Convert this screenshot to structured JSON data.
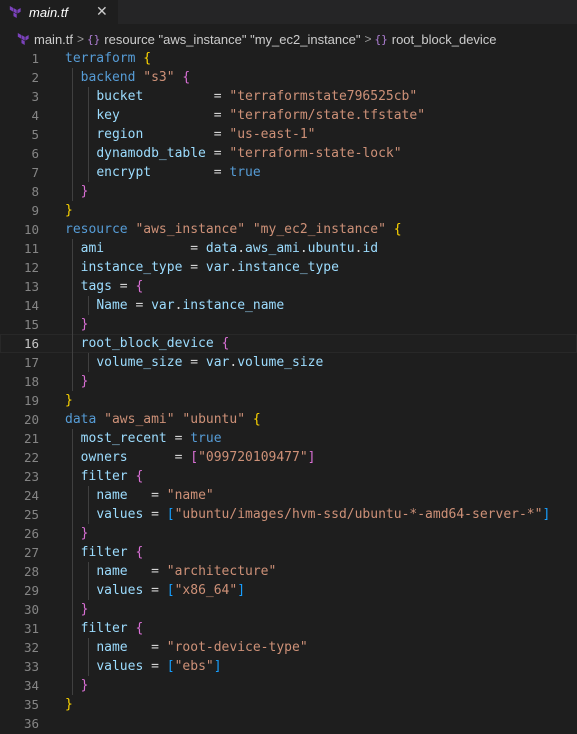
{
  "tab": {
    "filename": "main.tf",
    "close_glyph": "✕"
  },
  "breadcrumb": {
    "file": "main.tf",
    "resource": "resource \"aws_instance\" \"my_ec2_instance\"",
    "block": "root_block_device",
    "separator": ">"
  },
  "editor": {
    "current_line": 16,
    "lines": [
      {
        "n": "1",
        "tokens": [
          [
            "k",
            "terraform"
          ],
          [
            "op",
            " "
          ],
          [
            "br1",
            "{"
          ]
        ]
      },
      {
        "n": "2",
        "tokens": [
          [
            "op",
            "  "
          ],
          [
            "k",
            "backend"
          ],
          [
            "op",
            " "
          ],
          [
            "str",
            "\"s3\""
          ],
          [
            "op",
            " "
          ],
          [
            "br2",
            "{"
          ]
        ]
      },
      {
        "n": "3",
        "tokens": [
          [
            "op",
            "    "
          ],
          [
            "id",
            "bucket"
          ],
          [
            "op",
            "         = "
          ],
          [
            "str",
            "\"terraformstate796525cb\""
          ]
        ]
      },
      {
        "n": "4",
        "tokens": [
          [
            "op",
            "    "
          ],
          [
            "id",
            "key"
          ],
          [
            "op",
            "            = "
          ],
          [
            "str",
            "\"terraform/state.tfstate\""
          ]
        ]
      },
      {
        "n": "5",
        "tokens": [
          [
            "op",
            "    "
          ],
          [
            "id",
            "region"
          ],
          [
            "op",
            "         = "
          ],
          [
            "str",
            "\"us-east-1\""
          ]
        ]
      },
      {
        "n": "6",
        "tokens": [
          [
            "op",
            "    "
          ],
          [
            "id",
            "dynamodb_table"
          ],
          [
            "op",
            " = "
          ],
          [
            "str",
            "\"terraform-state-lock\""
          ]
        ]
      },
      {
        "n": "7",
        "tokens": [
          [
            "op",
            "    "
          ],
          [
            "id",
            "encrypt"
          ],
          [
            "op",
            "        = "
          ],
          [
            "kw",
            "true"
          ]
        ]
      },
      {
        "n": "8",
        "tokens": [
          [
            "op",
            "  "
          ],
          [
            "br2",
            "}"
          ]
        ]
      },
      {
        "n": "9",
        "tokens": [
          [
            "br1",
            "}"
          ]
        ]
      },
      {
        "n": "10",
        "tokens": [
          [
            "k",
            "resource"
          ],
          [
            "op",
            " "
          ],
          [
            "str",
            "\"aws_instance\""
          ],
          [
            "op",
            " "
          ],
          [
            "str",
            "\"my_ec2_instance\""
          ],
          [
            "op",
            " "
          ],
          [
            "br1",
            "{"
          ]
        ]
      },
      {
        "n": "11",
        "tokens": [
          [
            "op",
            "  "
          ],
          [
            "id",
            "ami"
          ],
          [
            "op",
            "           = "
          ],
          [
            "id",
            "data"
          ],
          [
            "op",
            "."
          ],
          [
            "id",
            "aws_ami"
          ],
          [
            "op",
            "."
          ],
          [
            "id",
            "ubuntu"
          ],
          [
            "op",
            "."
          ],
          [
            "id",
            "id"
          ]
        ]
      },
      {
        "n": "12",
        "tokens": [
          [
            "op",
            "  "
          ],
          [
            "id",
            "instance_type"
          ],
          [
            "op",
            " = "
          ],
          [
            "id",
            "var"
          ],
          [
            "op",
            "."
          ],
          [
            "id",
            "instance_type"
          ]
        ]
      },
      {
        "n": "13",
        "tokens": [
          [
            "op",
            "  "
          ],
          [
            "id",
            "tags"
          ],
          [
            "op",
            " = "
          ],
          [
            "br2",
            "{"
          ]
        ]
      },
      {
        "n": "14",
        "tokens": [
          [
            "op",
            "    "
          ],
          [
            "id",
            "Name"
          ],
          [
            "op",
            " = "
          ],
          [
            "id",
            "var"
          ],
          [
            "op",
            "."
          ],
          [
            "id",
            "instance_name"
          ]
        ]
      },
      {
        "n": "15",
        "tokens": [
          [
            "op",
            "  "
          ],
          [
            "br2",
            "}"
          ]
        ]
      },
      {
        "n": "16",
        "tokens": [
          [
            "op",
            "  "
          ],
          [
            "id",
            "root_block_device"
          ],
          [
            "op",
            " "
          ],
          [
            "br2",
            "{"
          ]
        ]
      },
      {
        "n": "17",
        "tokens": [
          [
            "op",
            "    "
          ],
          [
            "id",
            "volume_size"
          ],
          [
            "op",
            " = "
          ],
          [
            "id",
            "var"
          ],
          [
            "op",
            "."
          ],
          [
            "id",
            "volume_size"
          ]
        ]
      },
      {
        "n": "18",
        "tokens": [
          [
            "op",
            "  "
          ],
          [
            "br2",
            "}"
          ]
        ]
      },
      {
        "n": "19",
        "tokens": [
          [
            "br1",
            "}"
          ]
        ]
      },
      {
        "n": "20",
        "tokens": [
          [
            "k",
            "data"
          ],
          [
            "op",
            " "
          ],
          [
            "str",
            "\"aws_ami\""
          ],
          [
            "op",
            " "
          ],
          [
            "str",
            "\"ubuntu\""
          ],
          [
            "op",
            " "
          ],
          [
            "br1",
            "{"
          ]
        ]
      },
      {
        "n": "21",
        "tokens": [
          [
            "op",
            "  "
          ],
          [
            "id",
            "most_recent"
          ],
          [
            "op",
            " = "
          ],
          [
            "kw",
            "true"
          ]
        ]
      },
      {
        "n": "22",
        "tokens": [
          [
            "op",
            "  "
          ],
          [
            "id",
            "owners"
          ],
          [
            "op",
            "      = "
          ],
          [
            "br2",
            "["
          ],
          [
            "str",
            "\"099720109477\""
          ],
          [
            "br2",
            "]"
          ]
        ]
      },
      {
        "n": "23",
        "tokens": [
          [
            "op",
            "  "
          ],
          [
            "id",
            "filter"
          ],
          [
            "op",
            " "
          ],
          [
            "br2",
            "{"
          ]
        ]
      },
      {
        "n": "24",
        "tokens": [
          [
            "op",
            "    "
          ],
          [
            "id",
            "name"
          ],
          [
            "op",
            "   = "
          ],
          [
            "str",
            "\"name\""
          ]
        ]
      },
      {
        "n": "25",
        "tokens": [
          [
            "op",
            "    "
          ],
          [
            "id",
            "values"
          ],
          [
            "op",
            " = "
          ],
          [
            "br3",
            "["
          ],
          [
            "str",
            "\"ubuntu/images/hvm-ssd/ubuntu-*-amd64-server-*\""
          ],
          [
            "br3",
            "]"
          ]
        ]
      },
      {
        "n": "26",
        "tokens": [
          [
            "op",
            "  "
          ],
          [
            "br2",
            "}"
          ]
        ]
      },
      {
        "n": "27",
        "tokens": [
          [
            "op",
            "  "
          ],
          [
            "id",
            "filter"
          ],
          [
            "op",
            " "
          ],
          [
            "br2",
            "{"
          ]
        ]
      },
      {
        "n": "28",
        "tokens": [
          [
            "op",
            "    "
          ],
          [
            "id",
            "name"
          ],
          [
            "op",
            "   = "
          ],
          [
            "str",
            "\"architecture\""
          ]
        ]
      },
      {
        "n": "29",
        "tokens": [
          [
            "op",
            "    "
          ],
          [
            "id",
            "values"
          ],
          [
            "op",
            " = "
          ],
          [
            "br3",
            "["
          ],
          [
            "str",
            "\"x86_64\""
          ],
          [
            "br3",
            "]"
          ]
        ]
      },
      {
        "n": "30",
        "tokens": [
          [
            "op",
            "  "
          ],
          [
            "br2",
            "}"
          ]
        ]
      },
      {
        "n": "31",
        "tokens": [
          [
            "op",
            "  "
          ],
          [
            "id",
            "filter"
          ],
          [
            "op",
            " "
          ],
          [
            "br2",
            "{"
          ]
        ]
      },
      {
        "n": "32",
        "tokens": [
          [
            "op",
            "    "
          ],
          [
            "id",
            "name"
          ],
          [
            "op",
            "   = "
          ],
          [
            "str",
            "\"root-device-type\""
          ]
        ]
      },
      {
        "n": "33",
        "tokens": [
          [
            "op",
            "    "
          ],
          [
            "id",
            "values"
          ],
          [
            "op",
            " = "
          ],
          [
            "br3",
            "["
          ],
          [
            "str",
            "\"ebs\""
          ],
          [
            "br3",
            "]"
          ]
        ]
      },
      {
        "n": "34",
        "tokens": [
          [
            "op",
            "  "
          ],
          [
            "br2",
            "}"
          ]
        ]
      },
      {
        "n": "35",
        "tokens": [
          [
            "br1",
            "}"
          ]
        ]
      },
      {
        "n": "36",
        "tokens": []
      }
    ]
  }
}
